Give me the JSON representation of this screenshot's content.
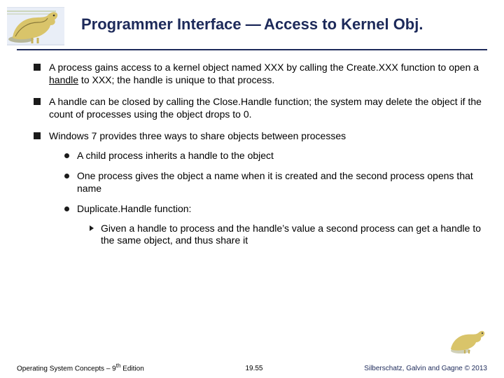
{
  "header": {
    "title_pre": "Programmer Interface ",
    "title_dash": "—",
    "title_post": "  Access to Kernel Obj."
  },
  "bullets": {
    "b1_pre": "A process gains access to a kernel object named XXX by calling the Create.XXX function to open a ",
    "b1_handle": "handle",
    "b1_post": " to XXX; the handle is unique to that process.",
    "b2": "A handle can be closed by calling the Close.Handle function; the system may delete the object if the count of processes using the object drops to 0.",
    "b3": "Windows 7 provides three ways to share objects between processes",
    "sub": {
      "s1": "A child process inherits a handle to the object",
      "s2": "One process gives the object a name when it is created and the second process opens that name",
      "s3": "Duplicate.Handle function:",
      "s3sub": "Given a handle to process and the handle’s value a second process can get a handle to the same object, and thus share it"
    }
  },
  "footer": {
    "left_pre": "Operating System Concepts – 9",
    "left_sup": "th",
    "left_post": " Edition",
    "center": "19.55",
    "right": "Silberschatz, Galvin and Gagne © 2013"
  }
}
